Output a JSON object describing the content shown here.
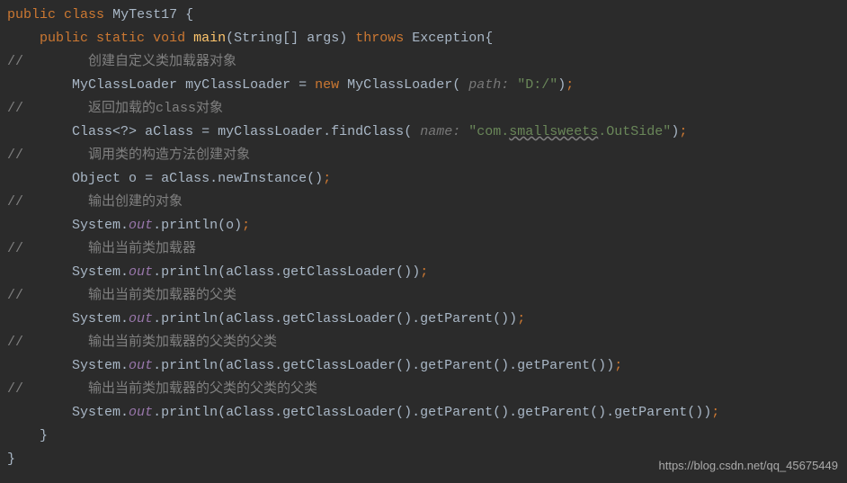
{
  "code": {
    "line1": {
      "kw_public": "public",
      "kw_class": "class",
      "class_name": "MyTest17",
      "brace": "{"
    },
    "line2": {
      "kw_public": "public",
      "kw_static": "static",
      "kw_void": "void",
      "method": "main",
      "param_type": "String",
      "brackets": "[]",
      "param_name": "args",
      "kw_throws": "throws",
      "exc": "Exception",
      "brace": "{"
    },
    "line3": {
      "marker": "//",
      "comment": "创建自定义类加载器对象"
    },
    "line4": {
      "type": "MyClassLoader",
      "var": "myClassLoader",
      "eq": "=",
      "kw_new": "new",
      "ctor": "MyClassLoader",
      "hint": "path:",
      "str": "\"D:/\""
    },
    "line5": {
      "marker": "//",
      "comment": "返回加载的class对象"
    },
    "line6": {
      "type": "Class",
      "generic": "<?>",
      "var": "aClass",
      "eq": "=",
      "obj": "myClassLoader",
      "method": "findClass",
      "hint": "name:",
      "str_pre": "\"com.",
      "str_warn": "smallsweets",
      "str_post": ".OutSide\""
    },
    "line7": {
      "marker": "//",
      "comment": "调用类的构造方法创建对象"
    },
    "line8": {
      "type": "Object",
      "var": "o",
      "eq": "=",
      "obj": "aClass",
      "method": "newInstance",
      "paren": "()"
    },
    "line9": {
      "marker": "//",
      "comment": "输出创建的对象"
    },
    "line10": {
      "sys": "System",
      "out": "out",
      "method": "println",
      "arg": "o"
    },
    "line11": {
      "marker": "//",
      "comment": "输出当前类加载器"
    },
    "line12": {
      "sys": "System",
      "out": "out",
      "method": "println",
      "arg_obj": "aClass",
      "arg_method": "getClassLoader",
      "arg_paren": "()"
    },
    "line13": {
      "marker": "//",
      "comment": "输出当前类加载器的父类"
    },
    "line14": {
      "sys": "System",
      "out": "out",
      "method": "println",
      "chain": "aClass.getClassLoader().getParent()"
    },
    "line15": {
      "marker": "//",
      "comment": "输出当前类加载器的父类的父类"
    },
    "line16": {
      "sys": "System",
      "out": "out",
      "method": "println",
      "chain": "aClass.getClassLoader().getParent().getParent()"
    },
    "line17": {
      "marker": "//",
      "comment": "输出当前类加载器的父类的父类的父类"
    },
    "line18": {
      "sys": "System",
      "out": "out",
      "method": "println",
      "chain": "aClass.getClassLoader().getParent().getParent().getParent()"
    },
    "line19": {
      "brace": "}"
    },
    "line20": {
      "brace": "}"
    }
  },
  "watermark": "https://blog.csdn.net/qq_45675449"
}
